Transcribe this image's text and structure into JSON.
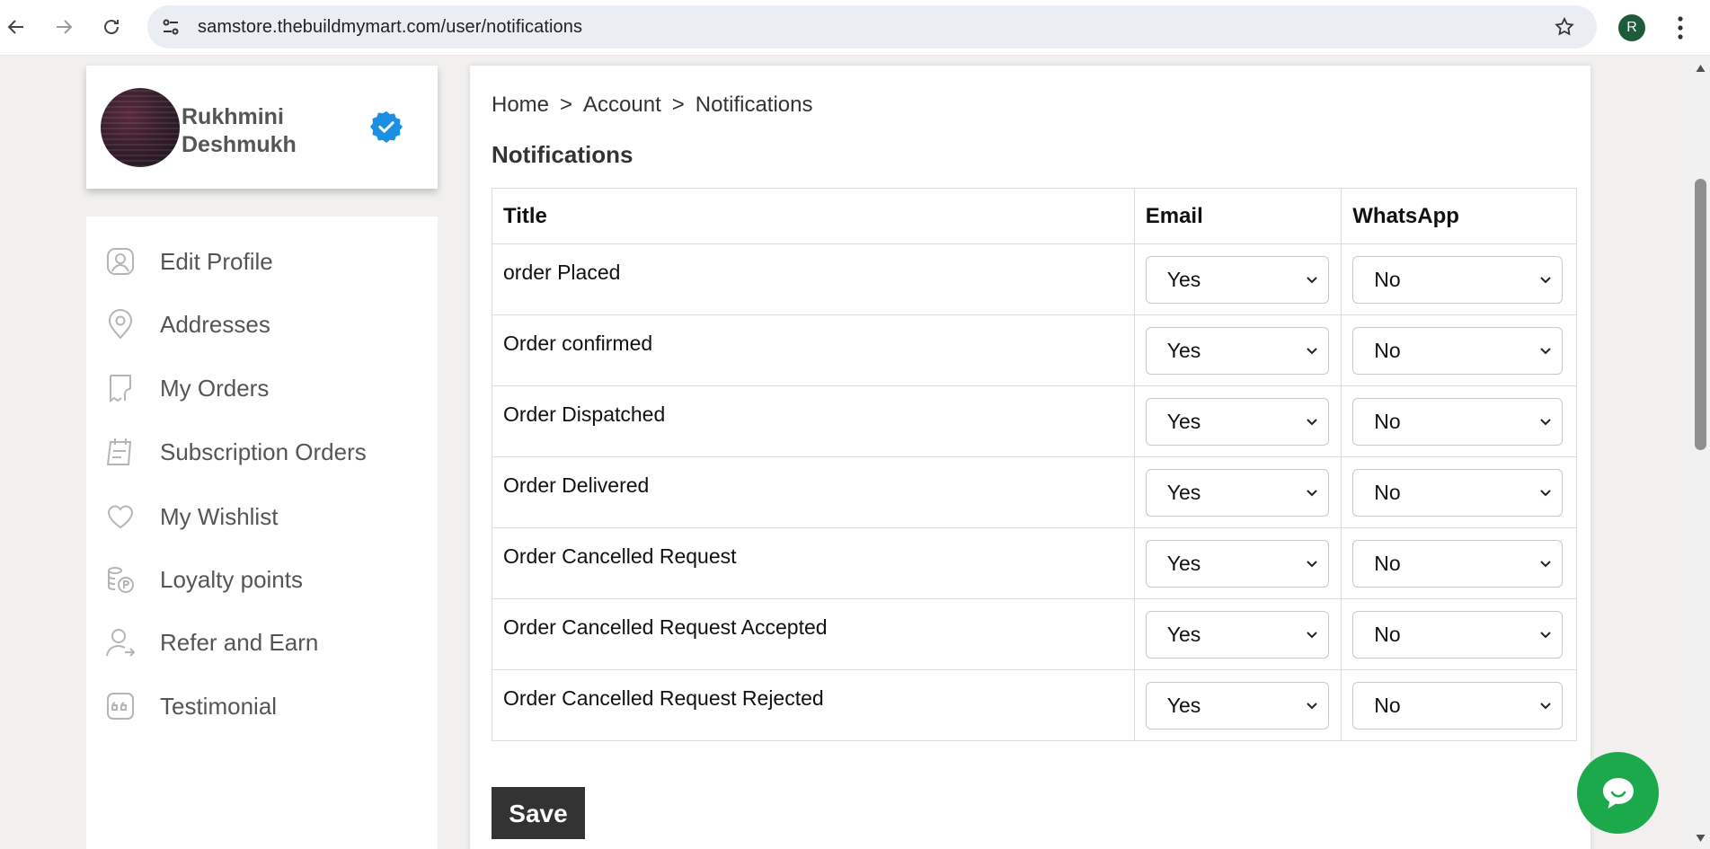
{
  "browser": {
    "url": "samstore.thebuildmymart.com/user/notifications",
    "profile_initial": "R"
  },
  "profile": {
    "name": "Rukhmini Deshmukh"
  },
  "sidebar": {
    "items": [
      {
        "label": "Edit Profile",
        "icon": "user-icon"
      },
      {
        "label": "Addresses",
        "icon": "location-pin-icon"
      },
      {
        "label": "My Orders",
        "icon": "receipt-icon"
      },
      {
        "label": "Subscription Orders",
        "icon": "calendar-icon"
      },
      {
        "label": "My Wishlist",
        "icon": "heart-icon"
      },
      {
        "label": "Loyalty points",
        "icon": "coins-icon"
      },
      {
        "label": "Refer and Earn",
        "icon": "refer-user-icon"
      },
      {
        "label": "Testimonial",
        "icon": "quote-icon"
      }
    ]
  },
  "breadcrumb": {
    "home": "Home",
    "sep": ">",
    "account": "Account",
    "current": "Notifications"
  },
  "main": {
    "title": "Notifications",
    "columns": {
      "title": "Title",
      "email": "Email",
      "whatsapp": "WhatsApp"
    },
    "rows": [
      {
        "title": "order Placed",
        "email": "Yes",
        "whatsapp": "No"
      },
      {
        "title": "Order confirmed",
        "email": "Yes",
        "whatsapp": "No"
      },
      {
        "title": "Order Dispatched",
        "email": "Yes",
        "whatsapp": "No"
      },
      {
        "title": "Order Delivered",
        "email": "Yes",
        "whatsapp": "No"
      },
      {
        "title": "Order Cancelled Request",
        "email": "Yes",
        "whatsapp": "No"
      },
      {
        "title": "Order Cancelled Request Accepted",
        "email": "Yes",
        "whatsapp": "No"
      },
      {
        "title": "Order Cancelled Request Rejected",
        "email": "Yes",
        "whatsapp": "No"
      }
    ],
    "save_label": "Save"
  },
  "colors": {
    "save_button": "#333333",
    "chat_button": "#1ba94c",
    "verified_badge": "#1a8fe3",
    "chrome_omnibox": "#eaedf4"
  }
}
